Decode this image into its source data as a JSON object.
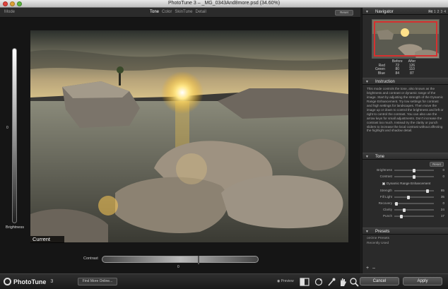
{
  "window": {
    "title": "PhotoTune 3 – _MG_0343And8more.psd (34.60%)"
  },
  "toolbar": {
    "mode_label": "Mode",
    "tabs": [
      {
        "label": "Tone",
        "active": true
      },
      {
        "label": "Color",
        "active": false
      },
      {
        "label": "SkinTune",
        "active": false
      },
      {
        "label": "Detail",
        "active": false
      }
    ],
    "reset_label": "Reset"
  },
  "canvas": {
    "brightness_label": "Brightness",
    "brightness_zero": "0",
    "current_label": "Current",
    "contrast_label": "Contrast",
    "contrast_zero": "0"
  },
  "navigator": {
    "title": "Navigator",
    "zoom_fit": "Fit",
    "zoom_levels": [
      "1",
      "2",
      "3",
      "4"
    ],
    "columns": [
      "Before",
      "After"
    ],
    "rows": [
      {
        "channel": "Red",
        "before": "72",
        "after": "126"
      },
      {
        "channel": "Green",
        "before": "80",
        "after": "110"
      },
      {
        "channel": "Blue",
        "before": "84",
        "after": "87"
      }
    ]
  },
  "instruction": {
    "title": "Instruction",
    "text": "This mode controls the tone, also known as the brightness and contrast or dynamic range of the image. Start by adjusting the strength of the Dynamic Range Enhancement. Try low settings for contrast and high settings for landscapes. Then move the image up or down to control the brightness and left or right to control the contrast. You can also use the arrow keys for small adjustments. Don't increase the contrast too much. Instead try the clarity or punch sliders to increase the local contrast without affecting the highlight and shadow detail."
  },
  "tone": {
    "title": "Tone",
    "reset_label": "Reset",
    "brightness": {
      "label": "Brightness",
      "value": "0",
      "level": 0.5
    },
    "contrast": {
      "label": "Contrast",
      "value": "0",
      "level": 0.5
    },
    "dre_label": "Dynamic Range Enhancement",
    "strength": {
      "label": "Strength",
      "value": "85",
      "level": 0.85
    },
    "fill_light": {
      "label": "Fill Light",
      "value": "35",
      "level": 0.35
    },
    "recovery": {
      "label": "Recovery",
      "value": "0",
      "level": 0.0
    },
    "clarity": {
      "label": "Clarity",
      "value": "24",
      "level": 0.24
    },
    "punch": {
      "label": "Punch",
      "value": "17",
      "level": 0.17
    }
  },
  "presets": {
    "title": "Presets",
    "items": [
      "onOne Presets",
      "Recently Used"
    ],
    "add_label": "+",
    "remove_label": "–"
  },
  "bottombar": {
    "brand": "PhotoTune",
    "version": "3",
    "find_more": "Find More Online...",
    "preview_label": "Preview",
    "cancel_label": "Cancel",
    "apply_label": "Apply"
  },
  "colors": {
    "accent_red": "#d63030",
    "panel_bg": "#2a2a2a",
    "canvas_bg": "#151515"
  }
}
